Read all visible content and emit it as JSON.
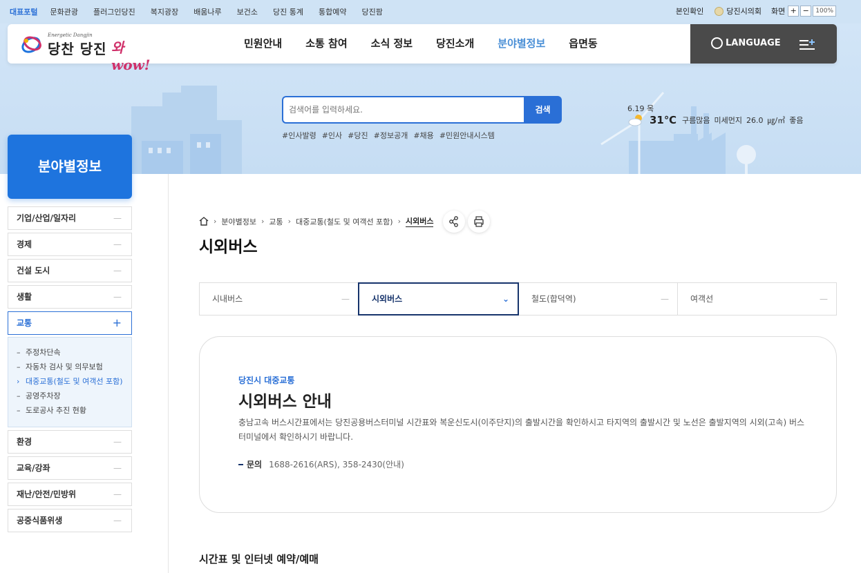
{
  "topbar": {
    "portal": "대표포털",
    "links": [
      "문화관광",
      "플러그인당진",
      "복지광장",
      "배움나루",
      "보건소",
      "당진 통계",
      "통합예약",
      "당진팜"
    ],
    "verify": "본인확인",
    "council": "당진시의회",
    "zoom_label": "화면",
    "zoom_in": "+",
    "zoom_out": "−",
    "zoom_value": "100%"
  },
  "header": {
    "logo_tagline": "Energetic Dangjin",
    "logo_text": "당찬 당진",
    "logo_wow": "와wow!",
    "menu": [
      "민원안내",
      "소통 참여",
      "소식 정보",
      "당진소개",
      "분야별정보",
      "읍면동"
    ],
    "active_menu_index": 4,
    "language": "LANGUAGE"
  },
  "search": {
    "placeholder": "검색어를 입력하세요.",
    "button": "검색",
    "tags": [
      "#인사발령",
      "#인사",
      "#당진",
      "#정보공개",
      "#채용",
      "#민원안내시스템"
    ]
  },
  "weather": {
    "date": "6.19 목",
    "temp": "31℃",
    "condition": "구름많음",
    "dust_label": "미세먼지",
    "dust_value": "26.0",
    "dust_unit": "㎍/㎥",
    "dust_status": "좋음"
  },
  "sidebar": {
    "title": "분야별정보",
    "items_before": [
      "기업/산업/일자리",
      "경제",
      "건설 도시",
      "생활"
    ],
    "open_item": "교통",
    "sub_items": [
      "주정차단속",
      "자동차 검사 및 의무보험",
      "대중교통(철도 및 여객선 포함)",
      "공영주차장",
      "도로공사 추진 현황"
    ],
    "current_sub_index": 2,
    "items_after": [
      "환경",
      "교육/강좌",
      "재난/안전/민방위",
      "공중식품위생"
    ]
  },
  "breadcrumb": [
    "분야별정보",
    "교통",
    "대중교통(철도 및 여객선 포함)",
    "시외버스"
  ],
  "page_title": "시외버스",
  "tabs": [
    "시내버스",
    "시외버스",
    "철도(합덕역)",
    "여객선"
  ],
  "active_tab_index": 1,
  "card": {
    "eyebrow": "당진시 대중교통",
    "title": "시외버스 안내",
    "description": "충남고속 버스시간표에서는 당진공용버스터미널 시간표와 복운신도시(이주단지)의 출발시간을 확인하시고 타지역의 출발시간 및 노선은 출발지역의 시외(고속) 버스터미널에서 확인하시기 바랍니다.",
    "contact_label": "문의",
    "contact_value": "1688-2616(ARS), 358-2430(안내)"
  },
  "section_title": "시간표 및 인터넷 예약/예매",
  "colors": {
    "primary": "#1e74de",
    "navy": "#16336b",
    "topbar_bg": "#cfe3f5",
    "hero_bg": "#d2e5f7"
  }
}
